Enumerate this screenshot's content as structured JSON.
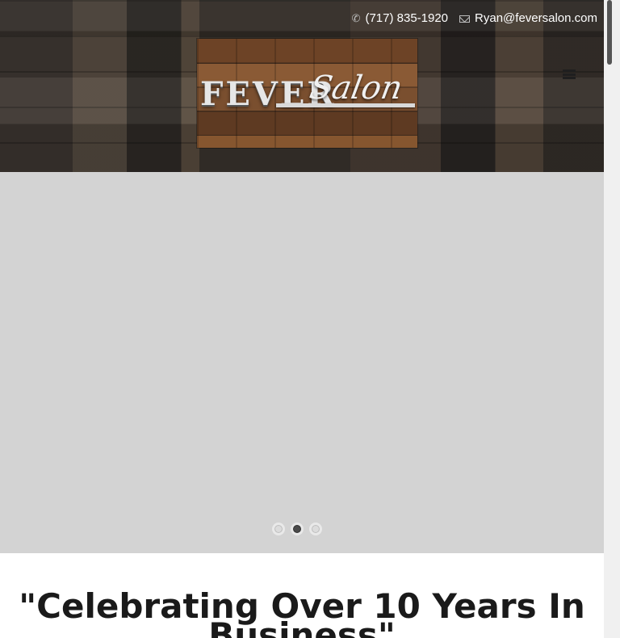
{
  "header": {
    "phone": "(717) 835-1920",
    "email": "Ryan@feversalon.com",
    "phone_icon": "phone-icon",
    "email_icon": "mail-icon",
    "menu_icon": "hamburger-menu-icon"
  },
  "logo": {
    "text_primary": "FEVER",
    "text_script": "Salon"
  },
  "slider": {
    "slide_count": 3,
    "active_slide": 2
  },
  "content": {
    "heading": "\"Celebrating Over 10 Years In Business\""
  }
}
